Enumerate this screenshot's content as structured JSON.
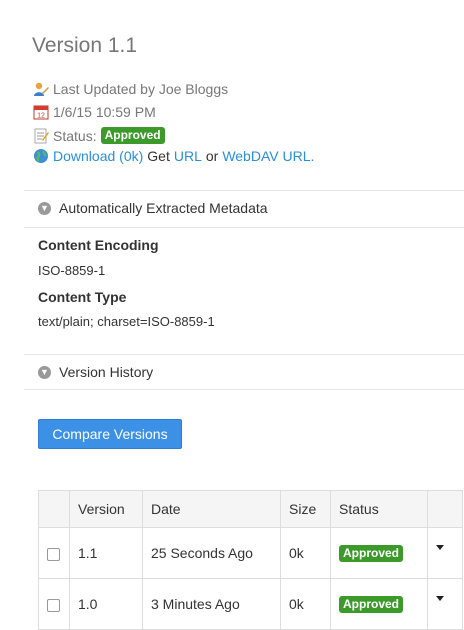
{
  "header": {
    "title": "Version 1.1"
  },
  "meta": {
    "updated_by": "Last Updated by Joe Bloggs",
    "date": "1/6/15 10:59 PM",
    "status_label": "Status:",
    "status_badge": "Approved",
    "download_link": "Download (0k)",
    "get_text": "Get",
    "url_link": "URL",
    "or_text": "or",
    "webdav_link": "WebDAV URL."
  },
  "metadata_section": {
    "header": "Automatically Extracted Metadata",
    "fields": [
      {
        "label": "Content Encoding",
        "value": "ISO-8859-1"
      },
      {
        "label": "Content Type",
        "value": "text/plain; charset=ISO-8859-1"
      }
    ]
  },
  "version_history": {
    "header": "Version History",
    "compare_button": "Compare Versions",
    "columns": [
      "Version",
      "Date",
      "Size",
      "Status"
    ],
    "rows": [
      {
        "version": "1.1",
        "date": "25 Seconds Ago",
        "size": "0k",
        "status": "Approved"
      },
      {
        "version": "1.0",
        "date": "3 Minutes Ago",
        "size": "0k",
        "status": "Approved"
      }
    ]
  },
  "colors": {
    "link": "#2a8fd6",
    "approved_badge": "#3c9a2a",
    "button": "#3c91e6"
  }
}
